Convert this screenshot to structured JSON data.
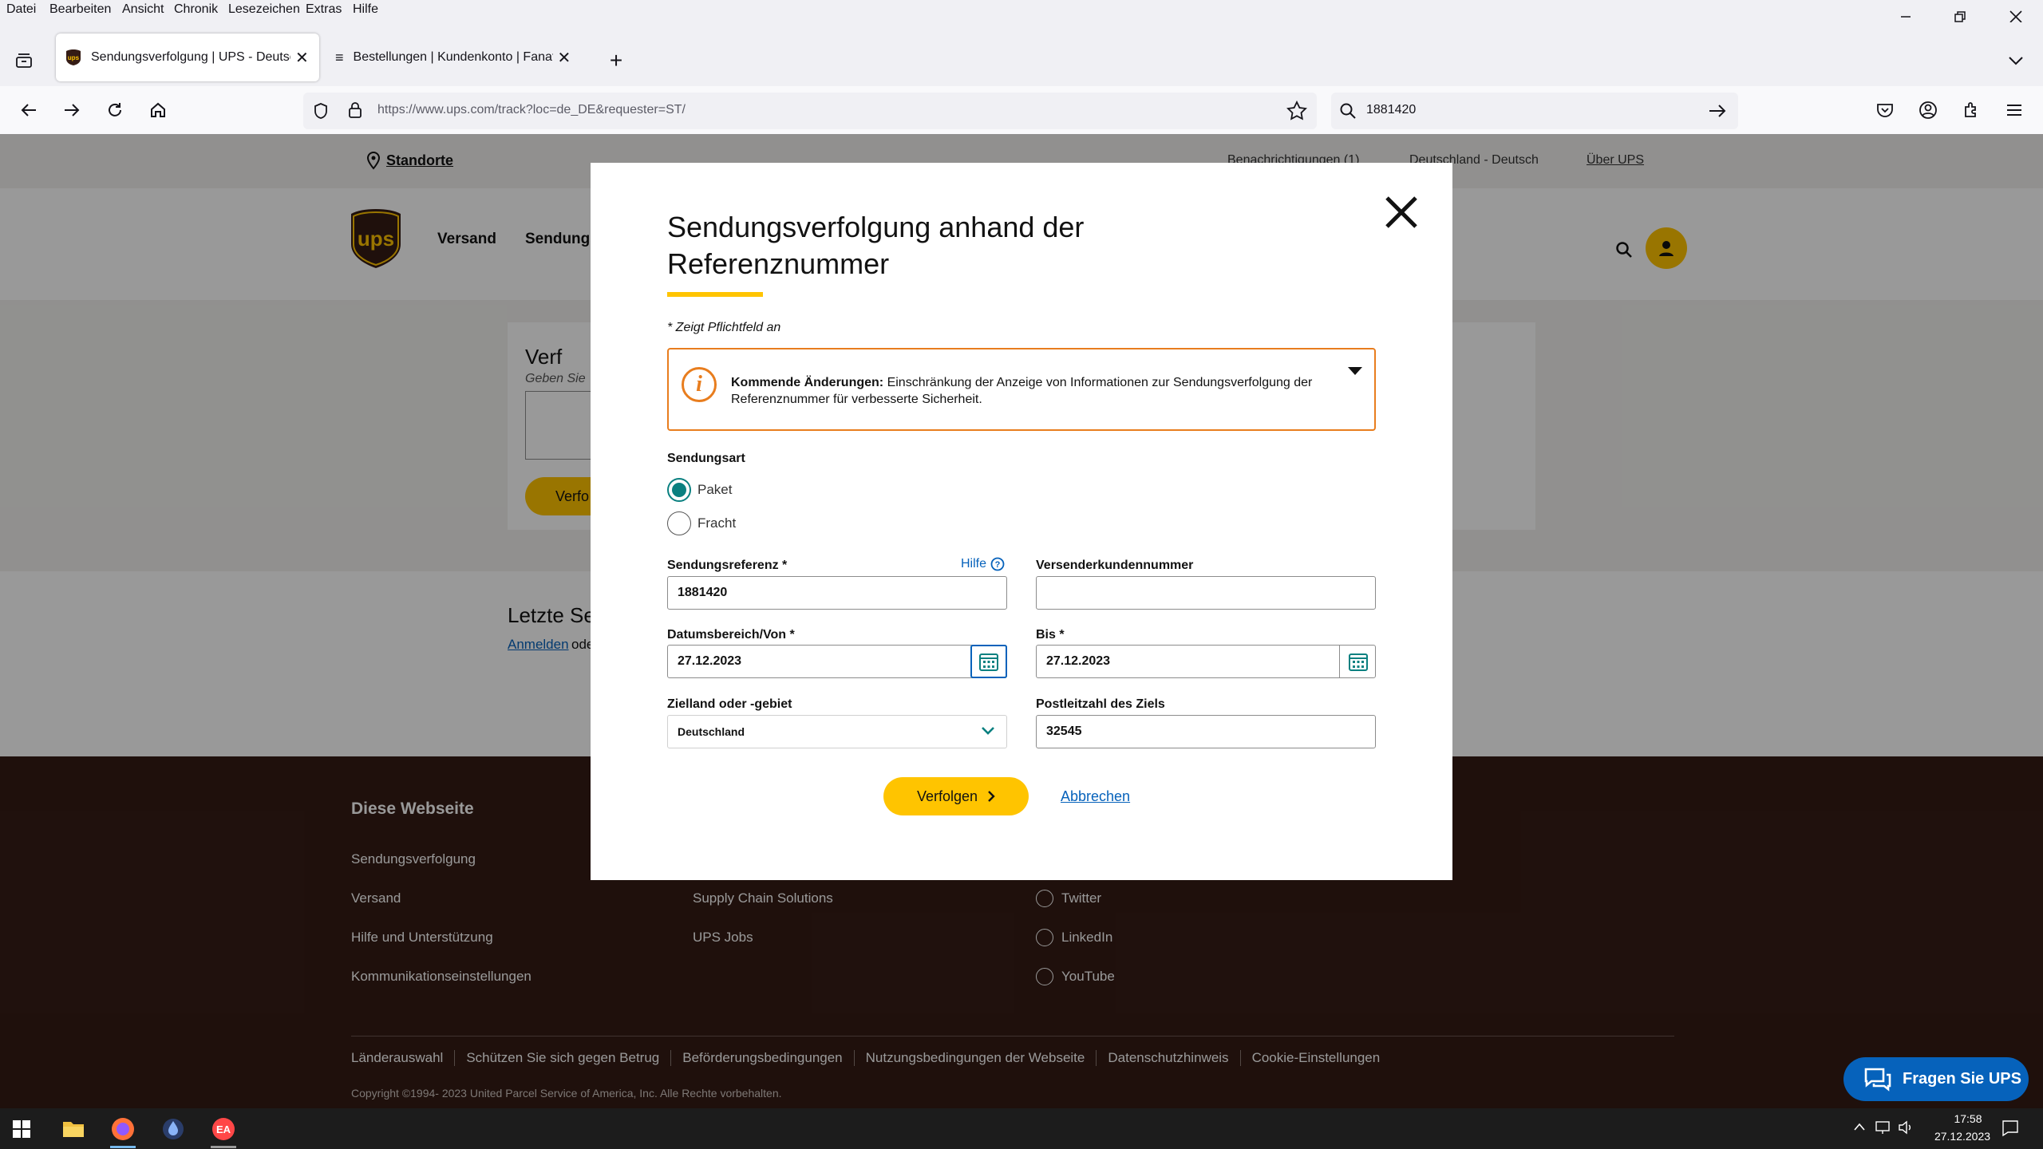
{
  "browser": {
    "menu": [
      "Datei",
      "Bearbeiten",
      "Ansicht",
      "Chronik",
      "Lesezeichen",
      "Extras",
      "Hilfe"
    ],
    "tabs": [
      {
        "label": "Sendungsverfolgung | UPS - Deutschla"
      },
      {
        "label": "Bestellungen | Kundenkonto | Fanatec"
      }
    ],
    "url": "https://www.ups.com/track?loc=de_DE&requester=ST/",
    "search_value": "1881420"
  },
  "ups_page": {
    "topbar": {
      "locations": "Standorte",
      "notifications": "Benachrichtigungen (1)",
      "language": "Deutschland - Deutsch",
      "about": "Über UPS"
    },
    "nav": [
      "Versand",
      "Sendungs"
    ],
    "track_card": {
      "title": "Verf",
      "hint": "Geben Sie",
      "button": "Verfo"
    },
    "recent": {
      "title": "Letzte Se",
      "login": "Anmelden",
      "login_suffix": "ode"
    },
    "footer": {
      "heading": "Diese Webseite",
      "col1": [
        "Sendungsverfolgung",
        "Versand",
        "Hilfe und Unterstützung",
        "Kommunikationseinstellungen"
      ],
      "col2": [
        "Supply Chain Solutions",
        "UPS Jobs"
      ],
      "col3": [
        "Twitter",
        "LinkedIn",
        "YouTube"
      ],
      "legal": [
        "Länderauswahl",
        "Schützen Sie sich gegen Betrug",
        "Beförderungsbedingungen",
        "Nutzungsbedingungen der Webseite",
        "Datenschutzhinweis",
        "Cookie-Einstellungen"
      ],
      "copyright": "Copyright ©1994- 2023 United Parcel Service of America, Inc. Alle Rechte vorbehalten."
    },
    "chat_button": "Fragen Sie UPS"
  },
  "modal": {
    "title_line1": "Sendungsverfolgung anhand der",
    "title_line2": "Referenznummer",
    "required_hint": "* Zeigt Pflichtfeld an",
    "notice_bold": "Kommende Änderungen:",
    "notice_text": " Einschränkung der Anzeige von Informationen zur Sendungsverfolgung der",
    "notice_text2": "Referenznummer für verbesserte Sicherheit.",
    "shipment_type_label": "Sendungsart",
    "radio_package": "Paket",
    "radio_freight": "Fracht",
    "ref_label": "Sendungsreferenz *",
    "help": "Hilfe",
    "ref_value": "1881420",
    "shipper_label": "Versenderkundennummer",
    "shipper_value": "",
    "date_from_label": "Datumsbereich/Von *",
    "date_from": "27.12.2023",
    "date_to_label": "Bis *",
    "date_to": "27.12.2023",
    "country_label": "Zielland oder -gebiet",
    "country_value": "Deutschland",
    "zip_label": "Postleitzahl des Ziels",
    "zip_value": "32545",
    "submit": "Verfolgen",
    "cancel": "Abbrechen"
  },
  "taskbar": {
    "time": "17:58",
    "date": "27.12.2023"
  },
  "colors": {
    "ups_brown": "#351c15",
    "ups_gold": "#ffc400",
    "accent_orange": "#e87d1e",
    "radio_teal": "#0a8080",
    "link_blue": "#0662bb",
    "chat_blue": "#0662bb"
  }
}
